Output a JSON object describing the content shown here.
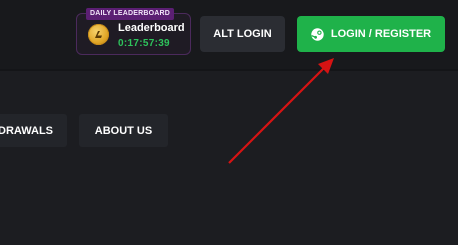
{
  "header": {
    "leaderboard": {
      "badge": "DAILY LEADERBOARD",
      "title": "Leaderboard",
      "timer": "0:17:57:39",
      "icon": "coin-icon"
    },
    "alt_login_label": "ALT LOGIN",
    "login_label": "LOGIN / REGISTER",
    "login_icon": "steam-icon"
  },
  "nav": {
    "items": [
      {
        "label": "DRAWALS"
      },
      {
        "label": "ABOUT US"
      }
    ]
  },
  "colors": {
    "background": "#1c1d21",
    "header": "#18191c",
    "accent_green": "#1fb24a",
    "timer_green": "#2ec35c",
    "badge_purple": "#5b1f73",
    "arrow_red": "#d61313"
  }
}
